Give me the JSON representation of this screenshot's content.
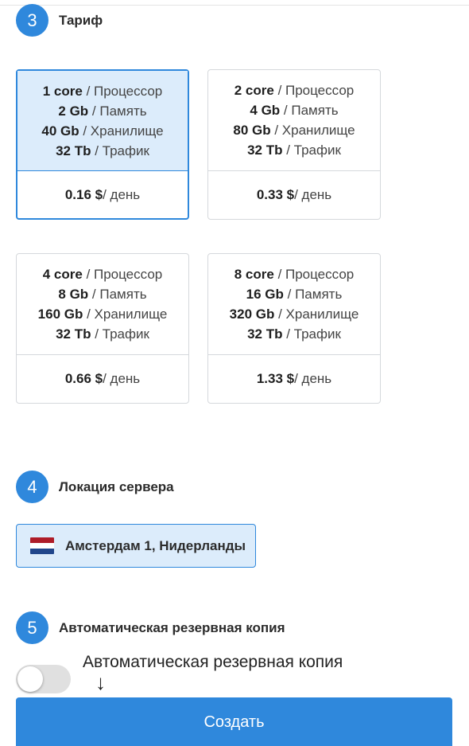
{
  "steps": {
    "tariff": {
      "number": "3",
      "title": "Тариф"
    },
    "location": {
      "number": "4",
      "title": "Локация сервера"
    },
    "backup": {
      "number": "5",
      "title": "Автоматическая резервная копия"
    }
  },
  "plans": [
    {
      "cpu": "1 core",
      "cpu_unit": " / Процессор",
      "ram": "2 Gb",
      "ram_unit": " / Память",
      "storage": "40 Gb",
      "storage_unit": " / Хранилище",
      "traffic": "32 Tb",
      "traffic_unit": " / Трафик",
      "price": "0.16 $",
      "price_unit": " / день",
      "selected": true
    },
    {
      "cpu": "2 core",
      "cpu_unit": " / Процессор",
      "ram": "4 Gb",
      "ram_unit": " / Память",
      "storage": "80 Gb",
      "storage_unit": " / Хранилище",
      "traffic": "32 Tb",
      "traffic_unit": " / Трафик",
      "price": "0.33 $",
      "price_unit": " / день",
      "selected": false
    },
    {
      "cpu": "4 core",
      "cpu_unit": " / Процессор",
      "ram": "8 Gb",
      "ram_unit": " / Память",
      "storage": "160 Gb",
      "storage_unit": " / Хранилище",
      "traffic": "32 Tb",
      "traffic_unit": " / Трафик",
      "price": "0.66 $",
      "price_unit": " / день",
      "selected": false
    },
    {
      "cpu": "8 core",
      "cpu_unit": " / Процессор",
      "ram": "16 Gb",
      "ram_unit": " / Память",
      "storage": "320 Gb",
      "storage_unit": " / Хранилище",
      "traffic": "32 Tb",
      "traffic_unit": " / Трафик",
      "price": "1.33 $",
      "price_unit": " / день",
      "selected": false
    }
  ],
  "location": {
    "label": "Амстердам 1, Нидерланды",
    "flag_icon": "netherlands-flag-icon",
    "flag_colors": [
      "#ae1c28",
      "#ffffff",
      "#21468b"
    ]
  },
  "backup": {
    "toggle_on": false,
    "annotation": "Автоматическая резервная копия",
    "arrow": "↓"
  },
  "create_button": {
    "label": "Создать"
  },
  "colors": {
    "accent": "#2f88dc",
    "selected_bg": "#dcecfb",
    "border": "#d5d8dc"
  }
}
